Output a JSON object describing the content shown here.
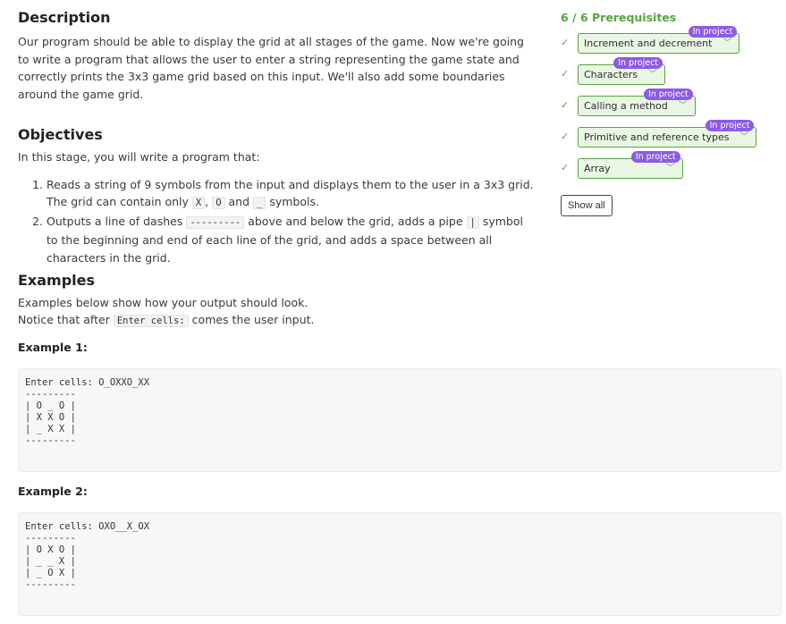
{
  "description": {
    "title": "Description",
    "text": "Our program should be able to display the grid at all stages of the game. Now we're going to write a program that allows the user to enter a string representing the game state and correctly prints the 3x3 game grid based on this input. We'll also add some boundaries around the game grid."
  },
  "objectives": {
    "title": "Objectives",
    "intro": "In this stage, you will write a program that:",
    "item1_a": "Reads a string of 9 symbols from the input and displays them to the user in a 3x3 grid. The grid can contain only",
    "item1_code_x": "X",
    "item1_sep": ",",
    "item1_code_o": "O",
    "item1_and": "and",
    "item1_code_u": "_",
    "item1_end": "symbols.",
    "item2_a": "Outputs a line of dashes",
    "item2_code_dash": "---------",
    "item2_b": "above and below the grid, adds a pipe",
    "item2_code_pipe": "|",
    "item2_c": "symbol to the beginning and end of each line of the grid, and adds a space between all characters in the grid."
  },
  "examples": {
    "title": "Examples",
    "intro1": "Examples below show how your output should look.",
    "intro2_a": "Notice that after",
    "intro2_code": "Enter cells:",
    "intro2_b": "comes the user input.",
    "ex1_label": "Example 1:",
    "ex1_code": "Enter cells: O_OXXO_XX\n---------\n| O _ O |\n| X X O |\n| _ X X |\n---------",
    "ex2_label": "Example 2:",
    "ex2_code": "Enter cells: OXO__X_OX\n---------\n| O X O |\n| _ _ X |\n| _ O X |\n---------"
  },
  "prereqs": {
    "title": "6 / 6 Prerequisites",
    "badge": "In project",
    "items": [
      {
        "label": "Increment and decrement"
      },
      {
        "label": "Characters"
      },
      {
        "label": "Calling a method"
      },
      {
        "label": "Primitive and reference types"
      },
      {
        "label": "Array"
      }
    ],
    "show_all": "Show all"
  },
  "colors": {
    "accent_green": "#53a53f",
    "badge_purple": "#8c5be8"
  },
  "icons": {
    "check": "check-icon",
    "chevron": "chevron-down-icon"
  }
}
